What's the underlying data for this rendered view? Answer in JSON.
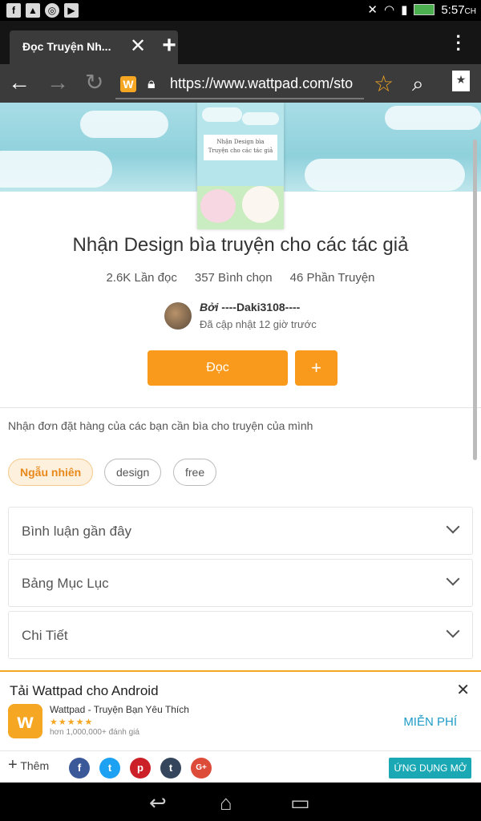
{
  "status_bar": {
    "left_icons": [
      "facebook-icon",
      "gallery-icon",
      "chrome-icon",
      "play-store-icon"
    ],
    "time": "5:57",
    "charging": "CH"
  },
  "browser": {
    "tab_title": "Đọc Truyện Nh...",
    "url": "https://www.wattpad.com/sto",
    "site_icon_letter": "W"
  },
  "story": {
    "title": "Nhận Design bìa truyện cho các tác giả",
    "reads": "2.6K Lần đọc",
    "votes": "357 Bình chọn",
    "parts": "46 Phần Truyện",
    "author_prefix": "Bởi",
    "author": "----Daki3108----",
    "updated": "Đã cập nhật 12 giờ trước",
    "read_button": "Đọc",
    "add_button": "+",
    "description": "Nhận đơn đặt hàng của các bạn cần bìa cho truyện của mình",
    "cover_text_line1": "Nhận Design bìa",
    "cover_text_line2": "Truyện cho các tác giả",
    "tags": [
      "Ngẫu nhiên",
      "design",
      "free"
    ],
    "sections": [
      "Bình luận gần đây",
      "Bảng Mục Lục",
      "Chi Tiết"
    ]
  },
  "promo": {
    "title": "Tải Wattpad cho Android",
    "app_name": "Wattpad - Truyện Bạn Yêu Thích",
    "stars": "★★★★★",
    "rating_count": "hơn 1,000,000+ đánh giá",
    "free_button": "MIỄN PHÍ",
    "more_label": "Thêm",
    "open_button": "ỨNG DỤNG MỞ",
    "share_icons": [
      "facebook-icon",
      "twitter-icon",
      "pinterest-icon",
      "tumblr-icon",
      "google-plus-icon"
    ]
  },
  "colors": {
    "accent": "#f99a1c",
    "link": "#1e9bc7",
    "open_button": "#1aa8b5"
  }
}
